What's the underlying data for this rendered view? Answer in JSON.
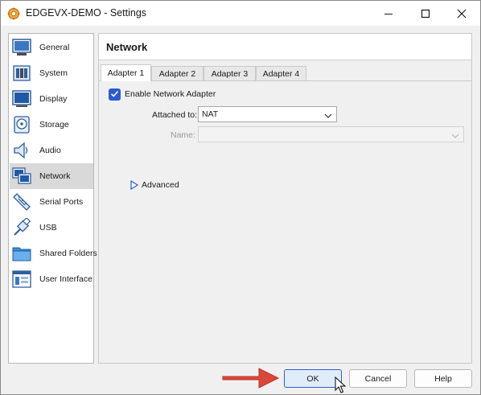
{
  "window": {
    "title": "EDGEVX-DEMO - Settings",
    "app_icon": "virtualbox-gear-icon",
    "controls": [
      "minimize-icon",
      "maximize-icon",
      "close-icon"
    ]
  },
  "sidebar": {
    "items": [
      {
        "label": "General",
        "icon": "general-icon",
        "selected": false
      },
      {
        "label": "System",
        "icon": "system-chip-icon",
        "selected": false
      },
      {
        "label": "Display",
        "icon": "display-monitor-icon",
        "selected": false
      },
      {
        "label": "Storage",
        "icon": "storage-disk-icon",
        "selected": false
      },
      {
        "label": "Audio",
        "icon": "audio-speaker-icon",
        "selected": false
      },
      {
        "label": "Network",
        "icon": "network-icon",
        "selected": true
      },
      {
        "label": "Serial Ports",
        "icon": "serial-port-icon",
        "selected": false
      },
      {
        "label": "USB",
        "icon": "usb-icon",
        "selected": false
      },
      {
        "label": "Shared Folders",
        "icon": "folder-icon",
        "selected": false
      },
      {
        "label": "User Interface",
        "icon": "user-interface-icon",
        "selected": false
      }
    ]
  },
  "page": {
    "title": "Network",
    "tabs": [
      {
        "label": "Adapter 1",
        "active": true
      },
      {
        "label": "Adapter 2",
        "active": false
      },
      {
        "label": "Adapter 3",
        "active": false
      },
      {
        "label": "Adapter 4",
        "active": false
      }
    ],
    "enable_adapter": {
      "label": "Enable Network Adapter",
      "checked": true
    },
    "attached_to": {
      "label": "Attached to:",
      "value": "NAT"
    },
    "name": {
      "label": "Name:",
      "value": "",
      "disabled": true
    },
    "advanced": {
      "label": "Advanced",
      "expanded": false
    }
  },
  "buttons": {
    "ok": "OK",
    "cancel": "Cancel",
    "help": "Help"
  },
  "colors": {
    "accent": "#2c5ad0",
    "annotation_arrow": "#d9483b"
  }
}
